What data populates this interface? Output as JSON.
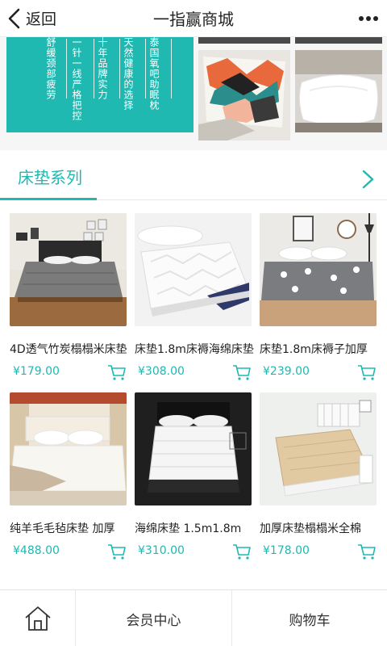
{
  "header": {
    "back_label": "返回",
    "title": "一指赢商城",
    "more_icon": "more-dots-icon"
  },
  "banner": {
    "background_color": "#1fb9b1",
    "lines": [
      "舒缓颈部疲劳",
      "一针一线严格把控",
      "十年品牌实力",
      "天然健康的选择",
      "泰国氧吧助眠枕"
    ]
  },
  "section": {
    "title": "床垫系列",
    "accent_color": "#1fb9b1",
    "more_icon": "chevron-right-icon"
  },
  "products": [
    {
      "name": "4D透气竹炭榻榻米床垫",
      "price": "¥179.00"
    },
    {
      "name": "床垫1.8m床褥海绵床垫",
      "price": "¥308.00"
    },
    {
      "name": "床垫1.8m床褥子加厚",
      "price": "¥239.00"
    },
    {
      "name": "纯羊毛毛毡床垫 加厚",
      "price": "¥488.00"
    },
    {
      "name": "海绵床垫 1.5m1.8m",
      "price": "¥310.00"
    },
    {
      "name": "加厚床垫榻榻米全棉",
      "price": "¥178.00"
    }
  ],
  "bottom_nav": {
    "home_icon": "home-icon",
    "member": "会员中心",
    "cart": "购物车"
  }
}
